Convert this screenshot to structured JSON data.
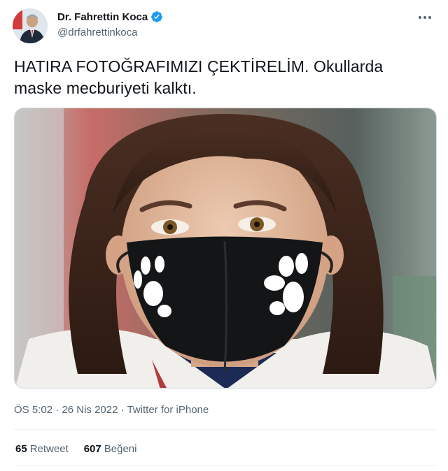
{
  "author": {
    "display_name": "Dr. Fahrettin Koca",
    "handle": "@drfahrettinkoca",
    "verified": true
  },
  "tweet": {
    "text_line1": "HATIRA FOTOĞRAFIMIZI ÇEKTİRELİM. Okullarda",
    "text_line2": "maske mecburiyeti kalktı.",
    "time": "ÖS 5:02",
    "sep": " · ",
    "date": "26 Nis 2022",
    "source": "Twitter for iPhone"
  },
  "stats": {
    "retweets_count": "65",
    "retweets_label": "Retweet",
    "likes_count": "607",
    "likes_label": "Beğeni"
  },
  "icons": {
    "verified": "verified-badge-icon",
    "more": "more-horizontal-icon"
  },
  "colors": {
    "verified_blue": "#1d9bf0",
    "text_primary": "#0f1419",
    "text_secondary": "#536471",
    "divider": "#eff3f4"
  }
}
